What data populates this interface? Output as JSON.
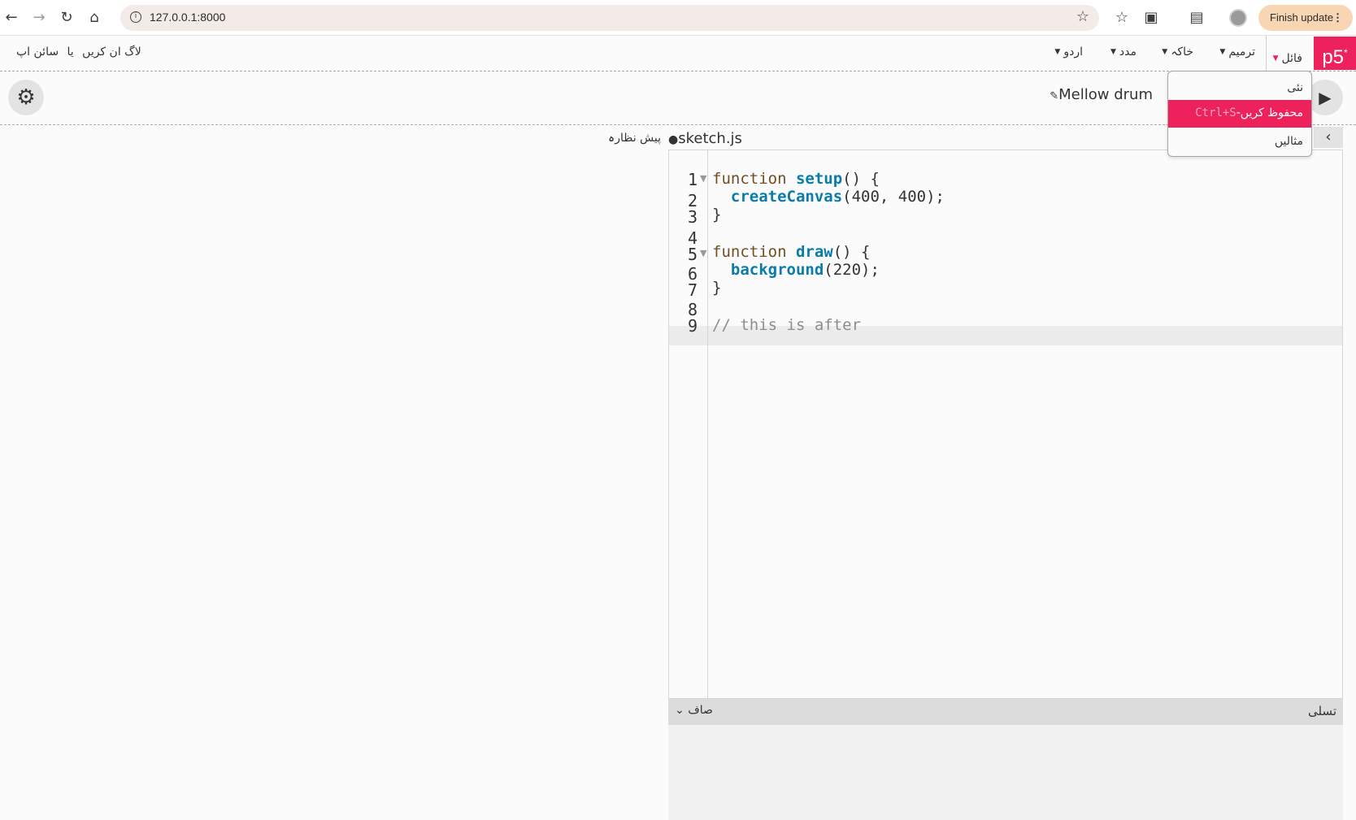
{
  "browser": {
    "url": "127.0.0.1:8000",
    "finish_update": "Finish update"
  },
  "nav": {
    "logo": "p5",
    "logo_sup": "*",
    "file": "فائل",
    "edit": "ترمیم",
    "sketch": "خاکہ",
    "help": "مدد",
    "language": "اردو",
    "login": "لاگ ان کریں",
    "or": "یا",
    "signup": "سائن اپ"
  },
  "toolbar": {
    "project_name": "Mellow drum"
  },
  "file_menu": {
    "new": "نئی",
    "save": "محفوظ کریں",
    "save_shortcut": "Ctrl+S",
    "examples": "مثالیں"
  },
  "editor": {
    "file_name": "sketch.js",
    "preview_label": "پیش نظارہ",
    "line_numbers": [
      "1",
      "2",
      "3",
      "4",
      "5",
      "6",
      "7",
      "8",
      "9"
    ],
    "lines": [
      {
        "kw": "function ",
        "fn": "setup",
        "rest": "() {"
      },
      {
        "kw": "",
        "fn": "createCanvas",
        "rest": "(400, 400);",
        "indent": "  "
      },
      {
        "rest": "}"
      },
      {
        "rest": ""
      },
      {
        "kw": "function ",
        "fn": "draw",
        "rest": "() {"
      },
      {
        "kw": "",
        "fn": "background",
        "rest": "(220);",
        "indent": "  "
      },
      {
        "rest": "}"
      },
      {
        "rest": ""
      },
      {
        "comment": "// this is after"
      }
    ]
  },
  "console": {
    "title": "تسلی",
    "clear": "صاف"
  },
  "colors": {
    "accent": "#ed225d",
    "keyword": "#704f21",
    "function": "#0b7ca9"
  }
}
